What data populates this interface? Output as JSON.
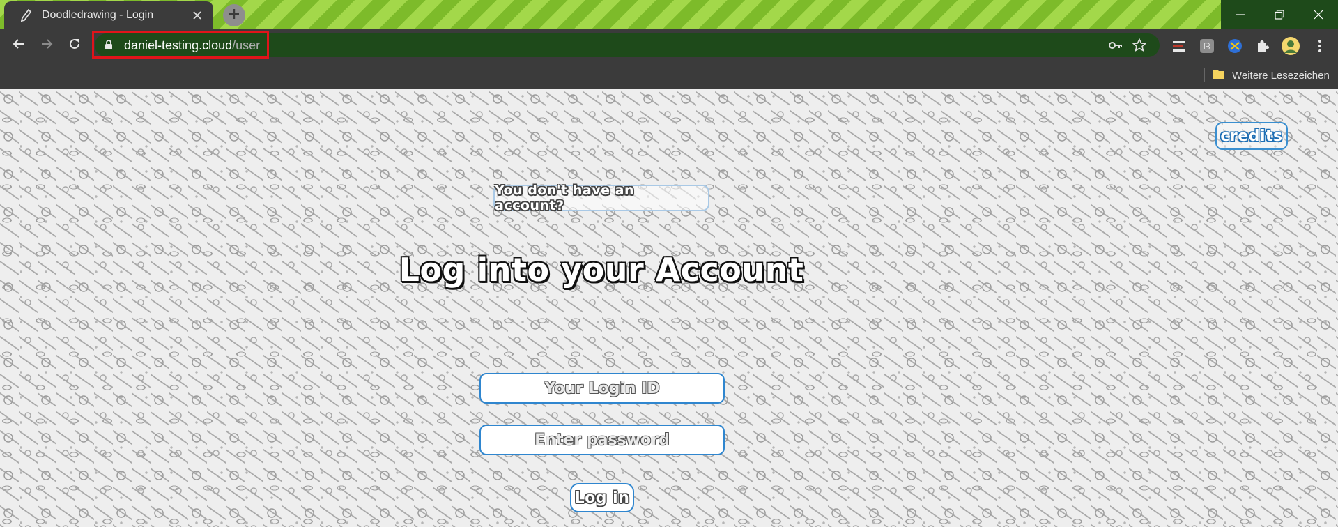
{
  "browser": {
    "tab": {
      "title": "Doodledrawing - Login"
    },
    "address": {
      "host": "daniel-testing.cloud",
      "path": "/user"
    },
    "bookmarks": {
      "folder_label": "Weitere Lesezeichen"
    },
    "icons": {
      "favicon": "pencil-icon",
      "tab_close": "close-icon",
      "new_tab": "plus-icon",
      "back": "arrow-left-icon",
      "forward": "arrow-right-icon",
      "reload": "reload-icon",
      "lock": "lock-icon",
      "key": "key-icon",
      "bookmark_star": "star-icon",
      "extensions": "puzzle-icon",
      "menu": "kebab-menu-icon"
    },
    "colors": {
      "tabstrip_stripe_a": "#a3d84a",
      "tabstrip_stripe_b": "#7dbb2a",
      "omnibox": "#1e4a1a",
      "highlight": "#e0141a"
    }
  },
  "page": {
    "credits_label": "credits",
    "no_account_label": "You don't have an account?",
    "heading": "Log into your Account",
    "login_id_placeholder": "Your Login ID",
    "password_placeholder": "Enter password",
    "login_button_label": "Log in",
    "accent_color": "#2f86cf"
  }
}
